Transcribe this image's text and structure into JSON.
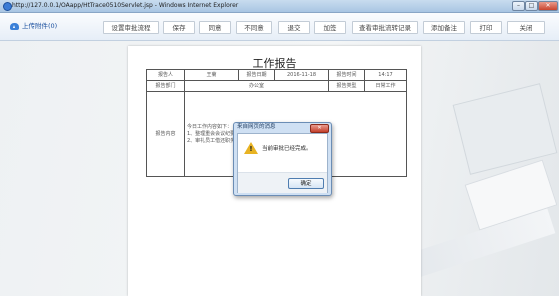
{
  "window": {
    "title": "http://127.0.0.1/OAapp/HtTrace0510Servlet.jsp - Windows Internet Explorer",
    "controls": [
      "–",
      "□",
      "✕"
    ]
  },
  "toolbar": {
    "upload_label": "上传附件(0)",
    "buttons": [
      "设置审批流程",
      "保存",
      "同意",
      "不同意",
      "退交",
      "加签",
      "查看审批流转记录",
      "添加备注",
      "打印",
      "关闭"
    ]
  },
  "report": {
    "title": "工作报告",
    "reporter_label": "报告人",
    "reporter": "王菊",
    "date_label": "报告日期",
    "date": "2016-11-18",
    "time_label": "报告时间",
    "time": "14:17",
    "dept_label": "报告部门",
    "dept": "办公室",
    "type_label": "报告类型",
    "type": "日常工作",
    "content_label": "报告内容",
    "content_lines": [
      "今日工作内容如下：",
      "1、整理重会会议纪要",
      "2、审礼员工借还职务"
    ]
  },
  "dialog": {
    "title": "来自网页的消息",
    "message": "当前审批已经完成。",
    "ok_label": "确定",
    "close_label": "✕"
  }
}
